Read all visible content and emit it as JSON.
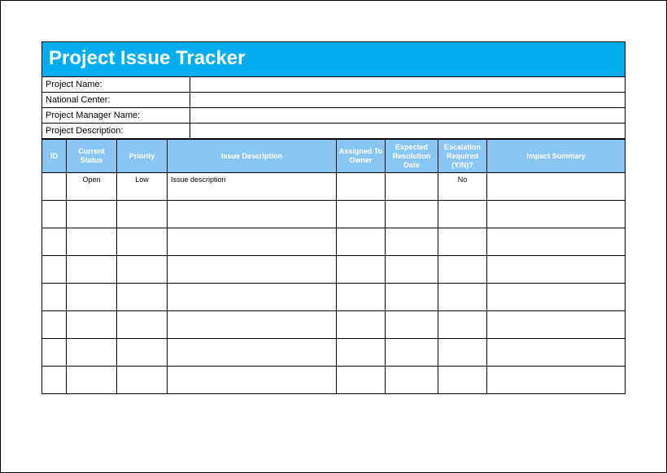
{
  "title": "Project Issue Tracker",
  "meta": {
    "project_name_label": "Project Name:",
    "project_name_value": "",
    "national_center_label": "National Center:",
    "national_center_value": "",
    "pm_name_label": "Project Manager Name:",
    "pm_name_value": "",
    "project_desc_label": "Project Description:",
    "project_desc_value": ""
  },
  "columns": {
    "id": "ID",
    "status": "Current Status",
    "priority": "Priority",
    "desc": "Issue Description",
    "owner": "Assigned To Owner",
    "date": "Expected Resolution Date",
    "escalation": "Escalation Required (Y/N)?",
    "impact": "Impact Summary"
  },
  "rows": [
    {
      "id": "",
      "status": "Open",
      "priority": "Low",
      "desc": "Issue description",
      "owner": "",
      "date": "",
      "escalation": "No",
      "impact": ""
    },
    {
      "id": "",
      "status": "",
      "priority": "",
      "desc": "",
      "owner": "",
      "date": "",
      "escalation": "",
      "impact": ""
    },
    {
      "id": "",
      "status": "",
      "priority": "",
      "desc": "",
      "owner": "",
      "date": "",
      "escalation": "",
      "impact": ""
    },
    {
      "id": "",
      "status": "",
      "priority": "",
      "desc": "",
      "owner": "",
      "date": "",
      "escalation": "",
      "impact": ""
    },
    {
      "id": "",
      "status": "",
      "priority": "",
      "desc": "",
      "owner": "",
      "date": "",
      "escalation": "",
      "impact": ""
    },
    {
      "id": "",
      "status": "",
      "priority": "",
      "desc": "",
      "owner": "",
      "date": "",
      "escalation": "",
      "impact": ""
    },
    {
      "id": "",
      "status": "",
      "priority": "",
      "desc": "",
      "owner": "",
      "date": "",
      "escalation": "",
      "impact": ""
    },
    {
      "id": "",
      "status": "",
      "priority": "",
      "desc": "",
      "owner": "",
      "date": "",
      "escalation": "",
      "impact": ""
    }
  ]
}
